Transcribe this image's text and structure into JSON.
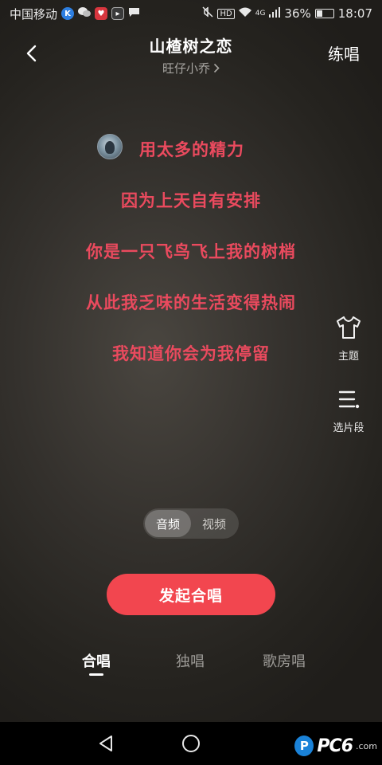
{
  "status_bar": {
    "carrier": "中国移动",
    "network": "4G",
    "battery": "36%",
    "battery_level": 0.36,
    "time": "18:07",
    "icons": [
      "app-k-icon",
      "wechat-icon",
      "app-heart-icon",
      "app-arrow-icon",
      "message-icon",
      "mute-icon",
      "hd-icon",
      "wifi-icon",
      "signal-icon",
      "battery-icon"
    ]
  },
  "header": {
    "title": "山楂树之恋",
    "singer": "旺仔小乔",
    "practice_label": "练唱"
  },
  "lyrics": [
    "用太多的精力",
    "因为上天自有安排",
    "你是一只飞鸟飞上我的树梢",
    "从此我乏味的生活变得热闹",
    "我知道你会为我停留"
  ],
  "side_actions": {
    "theme_label": "主题",
    "segment_label": "选片段"
  },
  "media_toggle": {
    "audio_label": "音频",
    "video_label": "视频",
    "selected": "音频"
  },
  "start_button": {
    "label": "发起合唱"
  },
  "tabs": [
    {
      "label": "合唱",
      "active": true
    },
    {
      "label": "独唱",
      "active": false
    },
    {
      "label": "歌房唱",
      "active": false
    }
  ],
  "watermark": {
    "text": "PC6",
    "sub": ".com"
  },
  "colors": {
    "lyric": "#ea4a5e",
    "primary_button": "#f2464f",
    "background": "#34312d"
  }
}
